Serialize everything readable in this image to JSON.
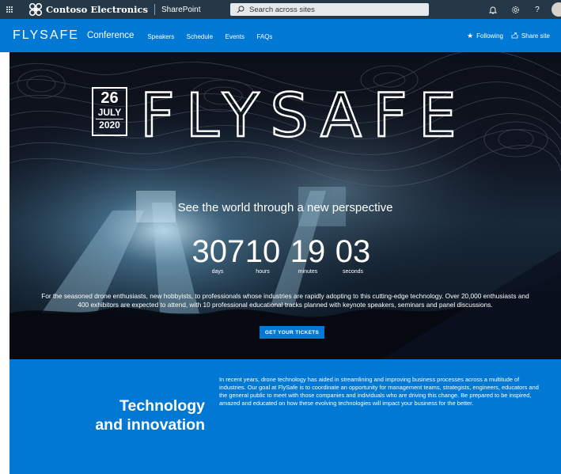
{
  "suitebar": {
    "org_name": "Contoso Electronics",
    "app_name": "SharePoint",
    "search_placeholder": "Search across sites",
    "icons": [
      "waffle-icon",
      "notifications-icon",
      "settings-icon",
      "help-icon"
    ]
  },
  "site_header": {
    "logo_text": "FLYSAFE",
    "site_name": "Conference",
    "nav": [
      "Speakers",
      "Schedule",
      "Events",
      "FAQs"
    ],
    "following_label": "Following",
    "share_label": "Share site"
  },
  "hero": {
    "date_day": "26",
    "date_month": "JULY",
    "date_year": "2020",
    "title_text": "FLYSAFE",
    "tagline": "See the world through a new perspective",
    "countdown": [
      {
        "value": "307",
        "label": "days"
      },
      {
        "value": "10",
        "label": "hours"
      },
      {
        "value": "19",
        "label": "minutes"
      },
      {
        "value": "03",
        "label": "seconds"
      }
    ],
    "description": "For the seasoned drone enthusiasts, new hobbyists, to professionals whose industries are rapidly adopting to this cutting-edge technology. Over 20,000 enthusiasts and 400 exhibitors are expected to attend, with 10 professional educational tracks planned with keynote speakers, seminars and panel discussions.",
    "cta_label": "GET YOUR TICKETS"
  },
  "about": {
    "title_line1": "Technology",
    "title_line2": "and innovation",
    "body": "In recent years, drone technology has aided in streamlining and improving business processes across a multitude of industries. Our goal at FlySafe is to coordinate an opportunity for management teams, strategists, engineers, educators and the general public to meet with those companies and individuals who are driving this change. Be prepared to be inspired, amazed and educated on how these evolving technologies will impact your business for the better."
  },
  "colors": {
    "suitebar_bg": "#253847",
    "brand_blue": "#0078d4",
    "hero_bg": "#0b0e16"
  }
}
